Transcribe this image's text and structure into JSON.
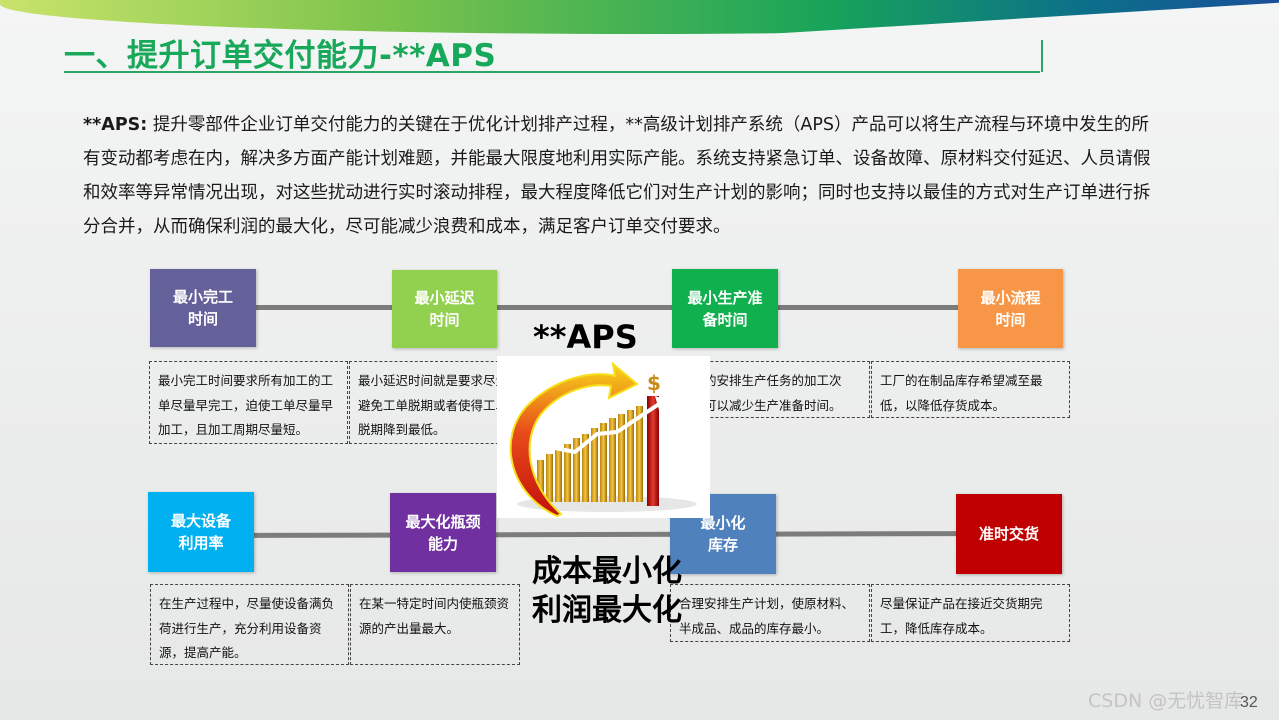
{
  "header": {
    "title": "一、提升订单交付能力-**APS"
  },
  "intro": {
    "lead": "**APS:",
    "body": " 提升零部件企业订单交付能力的关键在于优化计划排产过程，**高级计划排产系统（APS）产品可以将生产流程与环境中发生的所有变动都考虑在内，解决多方面产能计划难题，并能最大限度地利用实际产能。系统支持紧急订单、设备故障、原材料交付延迟、人员请假和效率等异常情况出现，对这些扰动进行实时滚动排程，最大程度降低它们对生产计划的影响；同时也支持以最佳的方式对生产订单进行拆分合并，从而确保利润的最大化，尽可能减少浪费和成本，满足客户订单交付要求。"
  },
  "center": {
    "aps": "**APS",
    "cost_line1": "成本最小化",
    "cost_line2": "利润最大化"
  },
  "top_row": [
    {
      "line1": "最小完工",
      "line2": "时间",
      "color": "#64609a",
      "desc": "最小完工时间要求所有加工的工单尽量早完工，迫使工单尽量早加工，且加工周期尽量短。"
    },
    {
      "line1": "最小延迟",
      "line2": "时间",
      "color": "#92d050",
      "desc": "最小延迟时间就是要求尽量避免工单脱期或者使得工单脱期降到最低。"
    },
    {
      "line1": "最小生产准",
      "line2": "备时间",
      "color": "#11b04e",
      "desc": "合理的安排生产任务的加工次序，可以减少生产准备时间。"
    },
    {
      "line1": "最小流程",
      "line2": "时间",
      "color": "#f79646",
      "desc": "工厂的在制品库存希望减至最低，以降低存货成本。"
    }
  ],
  "bottom_row": [
    {
      "line1": "最大设备",
      "line2": "利用率",
      "color": "#00b0f0",
      "desc": "在生产过程中，尽量使设备满负荷进行生产，充分利用设备资源，提高产能。"
    },
    {
      "line1": "最大化瓶颈",
      "line2": "能力",
      "color": "#7030a0",
      "desc": "在某一特定时间内使瓶颈资源的产出量最大。"
    },
    {
      "line1": "最小化",
      "line2": "库存",
      "color": "#4f81bd",
      "desc": "合理安排生产计划，使原材料、半成品、成品的库存最小。"
    },
    {
      "line1": "准时交货",
      "line2": "",
      "color": "#c00000",
      "desc": "尽量保证产品在接近交货期完工，降低库存成本。"
    }
  ],
  "footer": {
    "page_number": "32",
    "watermark": "CSDN @无忧智库"
  },
  "colors": {
    "title_green": "#18a85a",
    "connector_gray": "#7c7c7c"
  }
}
